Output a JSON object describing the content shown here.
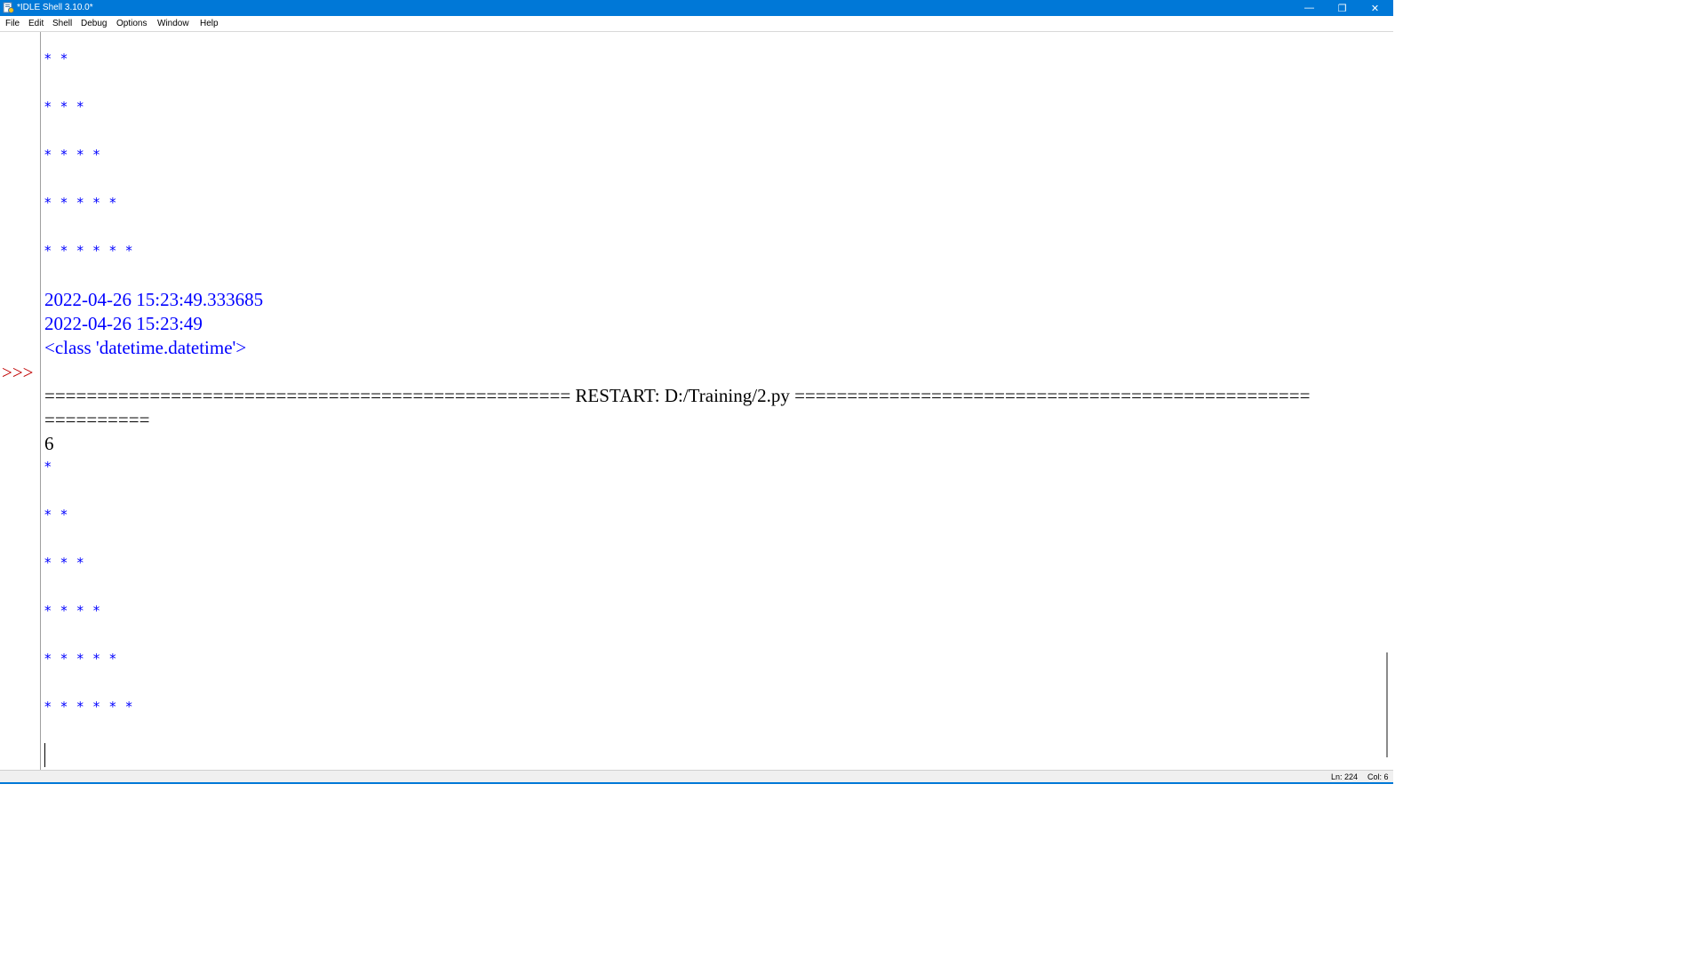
{
  "window": {
    "title": "*IDLE Shell 3.10.0*",
    "minimize_glyph": "—",
    "restore_glyph": "❐",
    "close_glyph": "✕"
  },
  "menu": [
    {
      "label": "File"
    },
    {
      "label": "Edit"
    },
    {
      "label": "Shell"
    },
    {
      "label": "Debug"
    },
    {
      "label": "Options"
    },
    {
      "label": "Window"
    },
    {
      "label": "Help"
    }
  ],
  "shell": {
    "prompt": ">>>",
    "lines": [
      {
        "text": "* *",
        "kind": "star"
      },
      {
        "text": "* * *",
        "kind": "star"
      },
      {
        "text": "* * * *",
        "kind": "star"
      },
      {
        "text": "* * * * *",
        "kind": "star"
      },
      {
        "text": "* * * * * *",
        "kind": "star"
      },
      {
        "text": "2022-04-26 15:23:49.333685",
        "kind": "output"
      },
      {
        "text": "2022-04-26 15:23:49",
        "kind": "output"
      },
      {
        "text": "<class 'datetime.datetime'>",
        "kind": "output"
      },
      {
        "text": "================================================== RESTART: D:/Training/2.py =================================================",
        "kind": "restart"
      },
      {
        "text": "==========",
        "kind": "restart"
      },
      {
        "text": "6",
        "kind": "input"
      },
      {
        "text": "*",
        "kind": "star"
      },
      {
        "text": "* *",
        "kind": "star"
      },
      {
        "text": "* * *",
        "kind": "star"
      },
      {
        "text": "* * * *",
        "kind": "star"
      },
      {
        "text": "* * * * *",
        "kind": "star"
      },
      {
        "text": "* * * * * *",
        "kind": "star"
      }
    ]
  },
  "status": {
    "line": "Ln: 224",
    "col": "Col: 6"
  },
  "colors": {
    "titlebar": "#0078d7",
    "output_text": "#0000ff",
    "prompt": "#c00000",
    "restart_text": "#000000"
  }
}
